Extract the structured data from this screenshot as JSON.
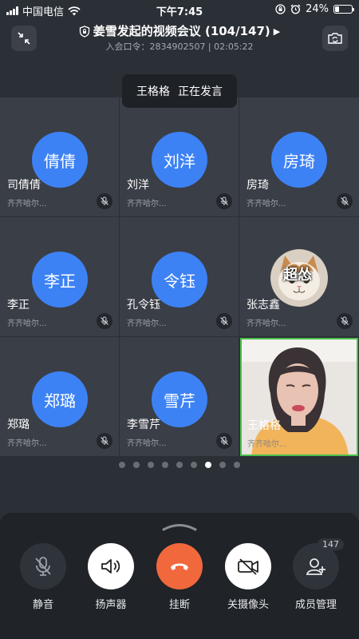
{
  "status_bar": {
    "carrier": "中国电信",
    "time": "下午7:45",
    "battery": "24%",
    "battery_level": 0.24
  },
  "header": {
    "title": "姜雪发起的视频会议 (104/147)",
    "meeting_info": "入会口令：2834902507 | 02:05:22"
  },
  "speaking_banner": {
    "name": "王格格",
    "status": "正在发言"
  },
  "participants": [
    {
      "avatar": "倩倩",
      "name": "司倩倩",
      "org": "齐齐哈尔..."
    },
    {
      "avatar": "刘洋",
      "name": "刘洋",
      "org": "齐齐哈尔..."
    },
    {
      "avatar": "房琦",
      "name": "房琦",
      "org": "齐齐哈尔..."
    },
    {
      "avatar": "李正",
      "name": "李正",
      "org": "齐齐哈尔..."
    },
    {
      "avatar": "令钰",
      "name": "孔令钰",
      "org": "齐齐哈尔..."
    },
    {
      "avatar": "超怂",
      "name": "张志鑫",
      "org": "齐齐哈尔..."
    },
    {
      "avatar": "郑璐",
      "name": "郑璐",
      "org": "齐齐哈尔..."
    },
    {
      "avatar": "雪芹",
      "name": "李雪芹",
      "org": "齐齐哈尔..."
    },
    {
      "avatar": "",
      "name": "王格格",
      "org": "齐齐哈尔..."
    }
  ],
  "pagination": {
    "total": 9,
    "current": 7
  },
  "controls": {
    "mute": "静音",
    "speaker": "扬声器",
    "hangup": "挂断",
    "camera_off": "关摄像头",
    "members": "成员管理",
    "members_count": "147"
  },
  "colors": {
    "avatar_blue": "#3d82f5",
    "hangup_orange": "#f0683c",
    "active_speaker_border": "#4bc04b"
  }
}
